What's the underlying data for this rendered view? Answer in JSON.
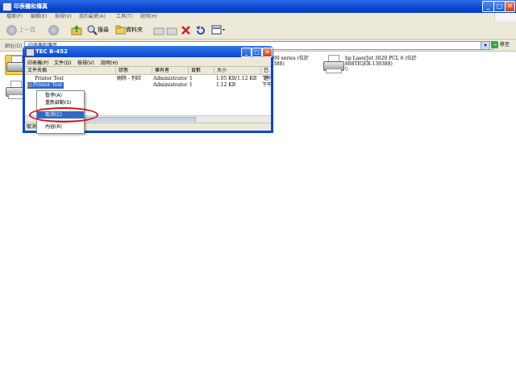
{
  "window": {
    "title": "印表機和傳真",
    "controls": {
      "minimize": "_",
      "maximize": "□",
      "close": "✕"
    }
  },
  "menubar": [
    "檔案(F)",
    "編輯(E)",
    "檢視(V)",
    "我的最愛(A)",
    "工具(T)",
    "說明(H)"
  ],
  "toolbar": {
    "back": "上一頁",
    "search": "搜尋",
    "folders": "資料夾"
  },
  "address": {
    "label": "網址(D)",
    "value": "印表機和傳真",
    "go": "移至",
    "go_arrow": "→",
    "drop": "▾"
  },
  "printers": [
    {
      "name_line1": "00 series (位於",
      "name_line2": "388)",
      "status": ""
    },
    {
      "name_line1": "hp LaserJet 3020 PCL 6 (位於",
      "name_line2": "888TIGER-139388)",
      "status": "0"
    }
  ],
  "dialog": {
    "title": "TEC B-452",
    "controls": {
      "minimize": "_",
      "maximize": "□",
      "close": "✕"
    },
    "menu": [
      "印表機(P)",
      "文件(D)",
      "檢視(V)",
      "說明(H)"
    ],
    "columns": [
      "文件名稱",
      "狀態",
      "擁有者",
      "頁數",
      "大小",
      "已送"
    ],
    "rows": [
      {
        "name": "Printer Test",
        "status": "刪除 - 列印",
        "owner": "Administrator",
        "pages": "1",
        "size": "1.05 KB/1.12 KB",
        "submitted": "下午"
      },
      {
        "name": "Printer Test",
        "status": "",
        "owner": "Administrator",
        "pages": "1",
        "size": "1.12 KB",
        "submitted": "下午"
      }
    ],
    "status_text": "取消"
  },
  "context_menu": {
    "items": [
      {
        "label": "暫停(A)",
        "selected": false
      },
      {
        "label": "重新啟動(S)",
        "selected": false
      },
      {
        "label": "取消(C)",
        "selected": true
      },
      {
        "label": "內容(R)",
        "selected": false
      }
    ]
  },
  "colors": {
    "titlebar": "#0a46cf",
    "selection": "#316ac5",
    "annotation": "#d01818"
  },
  "icons": [
    "printer-icon",
    "back-icon",
    "forward-icon",
    "up-folder-icon",
    "search-icon",
    "folders-icon",
    "undo-icon",
    "delete-icon",
    "views-icon",
    "go-icon"
  ]
}
